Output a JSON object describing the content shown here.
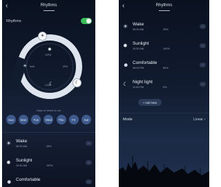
{
  "left": {
    "header": {
      "back_glyph": "‹",
      "title": "Rhythms"
    },
    "enable_row": {
      "label": "Rhythms",
      "enabled": true
    },
    "dial": {
      "handles": [
        {
          "icon": "sun-icon",
          "glyph": "☀"
        },
        {
          "icon": "moon-icon",
          "glyph": "☾"
        }
      ],
      "glyphs": {
        "sun": "✹",
        "moon": "☾"
      },
      "tick_labels": [
        "6AM",
        "12PM",
        "6PM",
        "12AM"
      ]
    },
    "days_caption": "Days of week to run",
    "days": [
      "Sun",
      "Mon",
      "Tue",
      "Wed",
      "Thu",
      "Fri",
      "Sat"
    ],
    "rhythms": [
      {
        "icon": "sunrise-icon",
        "glyph": "☀",
        "name": "Wake",
        "time": "06:30 AM",
        "brightness": "25%"
      },
      {
        "icon": "sun-icon",
        "glyph": "✹",
        "name": "Sunlight",
        "time": "10:30 AM",
        "brightness": "100%"
      },
      {
        "icon": "comfortable-icon",
        "glyph": "☻",
        "name": "Comfortable",
        "time": "",
        "brightness": ""
      }
    ]
  },
  "right": {
    "header": {
      "back_glyph": "‹",
      "title": "Rhythms"
    },
    "rhythms": [
      {
        "icon": "sunrise-icon",
        "glyph": "☀",
        "name": "Wake",
        "time": "06:30 AM",
        "brightness": "25%"
      },
      {
        "icon": "sun-icon",
        "glyph": "✹",
        "name": "Sunlight",
        "time": "10:30 AM",
        "brightness": "100%"
      },
      {
        "icon": "comfortable-icon",
        "glyph": "☻",
        "name": "Comfortable",
        "time": "06:00 PM",
        "brightness": "80%"
      },
      {
        "icon": "moon-icon",
        "glyph": "☾",
        "name": "Night light",
        "time": "11:00 PM",
        "brightness": "5%"
      }
    ],
    "add_new_label": "+ Add New",
    "mode": {
      "label": "Mode",
      "value": "Linear ›"
    }
  },
  "row_more_glyph": "⋯",
  "colors": {
    "toggle_on": "#3bbd5c",
    "day_chip": "#3e5a8c",
    "ring": "#dde4ee"
  }
}
